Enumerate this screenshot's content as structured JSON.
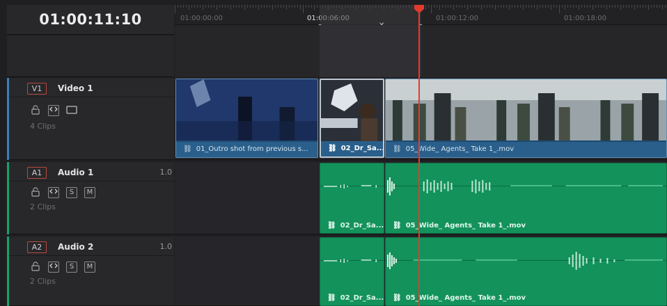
{
  "timeline": {
    "current_timecode": "01:00:11:10",
    "ruler_labels": [
      "01:00:00:00",
      "01:00:06:00",
      "01:00:12:00",
      "01:00:18:00"
    ]
  },
  "tracks": [
    {
      "badge": "V1",
      "name": "Video 1",
      "clips_count": "4 Clips",
      "level": "",
      "type": "video"
    },
    {
      "badge": "A1",
      "name": "Audio 1",
      "clips_count": "2 Clips",
      "level": "1.0",
      "type": "audio",
      "solo": "S",
      "mute": "M"
    },
    {
      "badge": "A2",
      "name": "Audio 2",
      "clips_count": "2 Clips",
      "level": "1.0",
      "type": "audio",
      "solo": "S",
      "mute": "M"
    }
  ],
  "video_clips": [
    {
      "name": "01_Outro shot from previous s..."
    },
    {
      "name": "02_Dr_Sa..."
    },
    {
      "name": "05_Wide_ Agents_ Take 1_.mov"
    }
  ],
  "audio_clips_a1": [
    {
      "name": "02_Dr_Sa..."
    },
    {
      "name": "05_Wide_ Agents_ Take 1_.mov"
    }
  ],
  "audio_clips_a2": [
    {
      "name": "02_Dr_Sa..."
    },
    {
      "name": "05_Wide_ Agents_ Take 1_.mov"
    }
  ],
  "colors": {
    "video_track_accent": "#3d7fb8",
    "audio_track_accent": "#19a06a",
    "playhead": "#e23b2e",
    "audio_clip": "#13925c",
    "video_clip_caption": "#2a5f8b"
  },
  "icons": {
    "lock": "lock-icon",
    "auto_select": "auto-select-icon",
    "monitor": "monitor-icon",
    "link": "link-icon"
  }
}
